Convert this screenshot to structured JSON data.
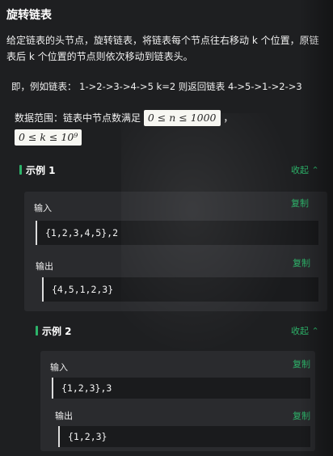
{
  "problem": {
    "title": "旋转链表",
    "description": "给定链表的头节点，旋转链表，将链表每个节点往右移动 k 个位置，原链表后 k 个位置的节点则依次移动到链表头。",
    "example_line": "即，例如链表： 1->2->3->4->5 k=2 则返回链表 4->5->1->2->3",
    "range_prefix": "数据范围：链表中节点数满足",
    "range_math_1": "0 ≤ n ≤ 1000",
    "range_sep": "，",
    "range_math_2": "0 ≤ k ≤ 10⁹"
  },
  "examples": [
    {
      "label": "示例 1",
      "collapse_label": "收起",
      "input_label": "输入",
      "input_value": "{1,2,3,4,5},2",
      "output_label": "输出",
      "output_value": "{4,5,1,2,3}",
      "copy_label": "复制"
    },
    {
      "label": "示例 2",
      "collapse_label": "收起",
      "input_label": "输入",
      "input_value": "{1,2,3},3",
      "output_label": "输出",
      "output_value": "{1,2,3}",
      "copy_label": "复制"
    }
  ],
  "icons": {
    "collapse": "chevron-up-icon"
  },
  "colors": {
    "accent": "#2db46a",
    "background": "#1e1f21",
    "panel": "#2a2b2e"
  }
}
